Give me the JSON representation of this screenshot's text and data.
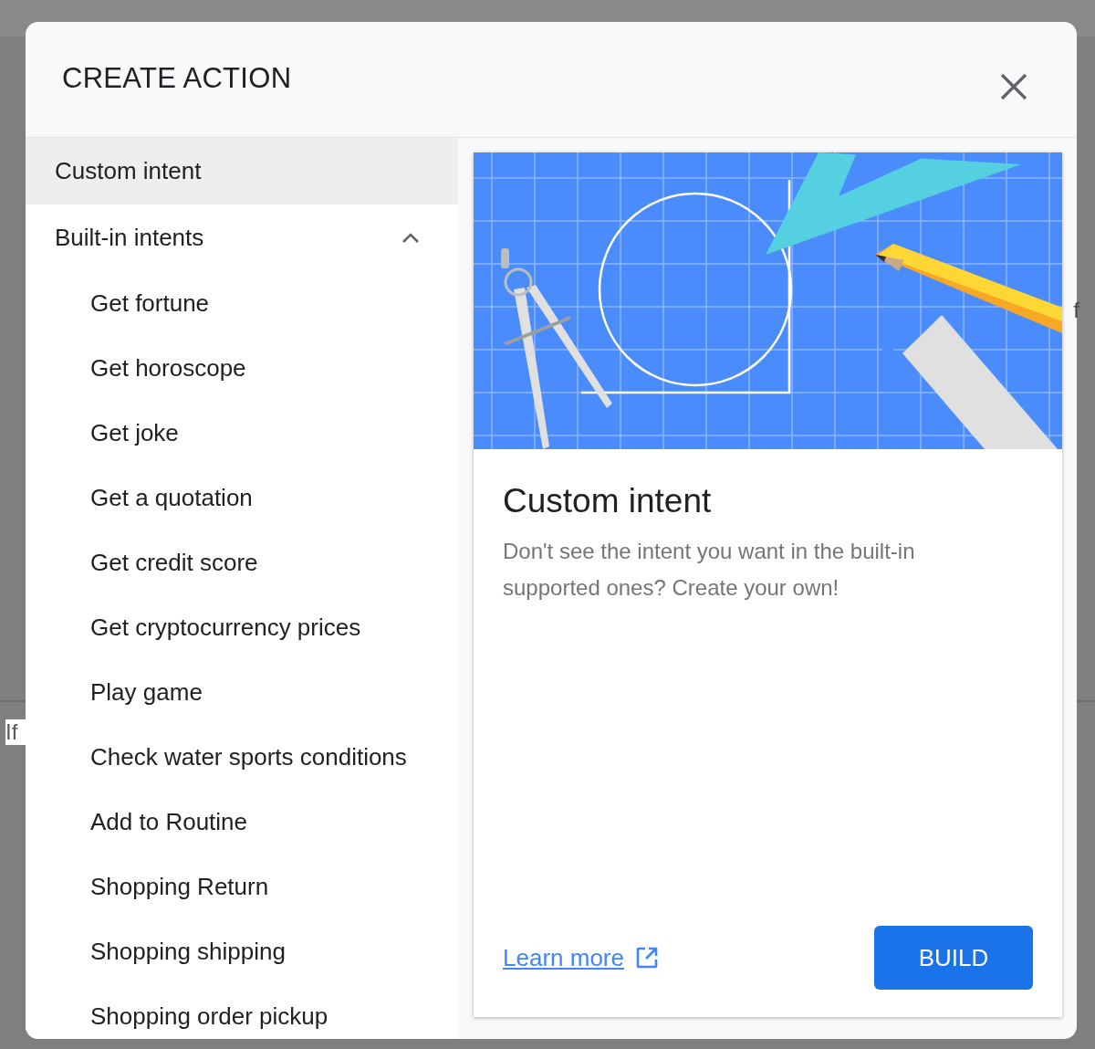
{
  "backdrop": {
    "texts": [
      "If",
      "f"
    ]
  },
  "dialog": {
    "title": "CREATE ACTION"
  },
  "intents": [
    {
      "label": "Custom intent",
      "kind": "item",
      "selected": true
    },
    {
      "label": "Built-in intents",
      "kind": "group",
      "selected": false,
      "expanded": true,
      "children": [
        {
          "label": "Get fortune",
          "selected": false
        },
        {
          "label": "Get horoscope",
          "selected": false
        },
        {
          "label": "Get joke",
          "selected": false
        },
        {
          "label": "Get a quotation",
          "selected": false
        },
        {
          "label": "Get credit score",
          "selected": false
        },
        {
          "label": "Get cryptocurrency prices",
          "selected": false
        },
        {
          "label": "Play game",
          "selected": false
        },
        {
          "label": "Check water sports conditions",
          "selected": false
        },
        {
          "label": "Add to Routine",
          "selected": false
        },
        {
          "label": "Shopping Return",
          "selected": false
        },
        {
          "label": "Shopping shipping",
          "selected": false
        },
        {
          "label": "Shopping order pickup",
          "selected": false
        }
      ]
    }
  ],
  "detail": {
    "title": "Custom intent",
    "description": "Don't see the intent you want in the built-in supported ones? Create your own!",
    "link": "Learn more",
    "button": "BUILD"
  }
}
